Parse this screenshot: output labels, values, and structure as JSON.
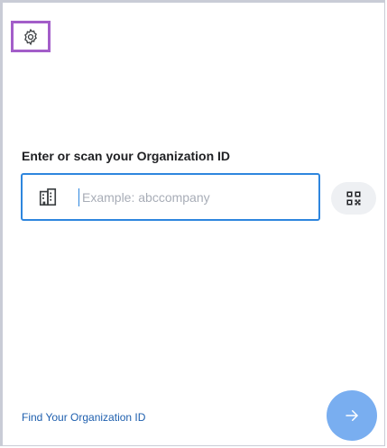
{
  "header": {
    "settings_icon": "gear-icon"
  },
  "org_form": {
    "prompt": "Enter or scan your Organization ID",
    "field_icon": "building-icon",
    "input_value": "",
    "input_placeholder": "Example: abccompany",
    "scan_icon": "qr-code-icon"
  },
  "footer": {
    "find_link": "Find Your Organization ID",
    "next_icon": "arrow-right-icon"
  },
  "colors": {
    "accent": "#2e86de",
    "next_button": "#79aef0",
    "highlight": "#a35ec9",
    "link": "#1e5fae"
  }
}
